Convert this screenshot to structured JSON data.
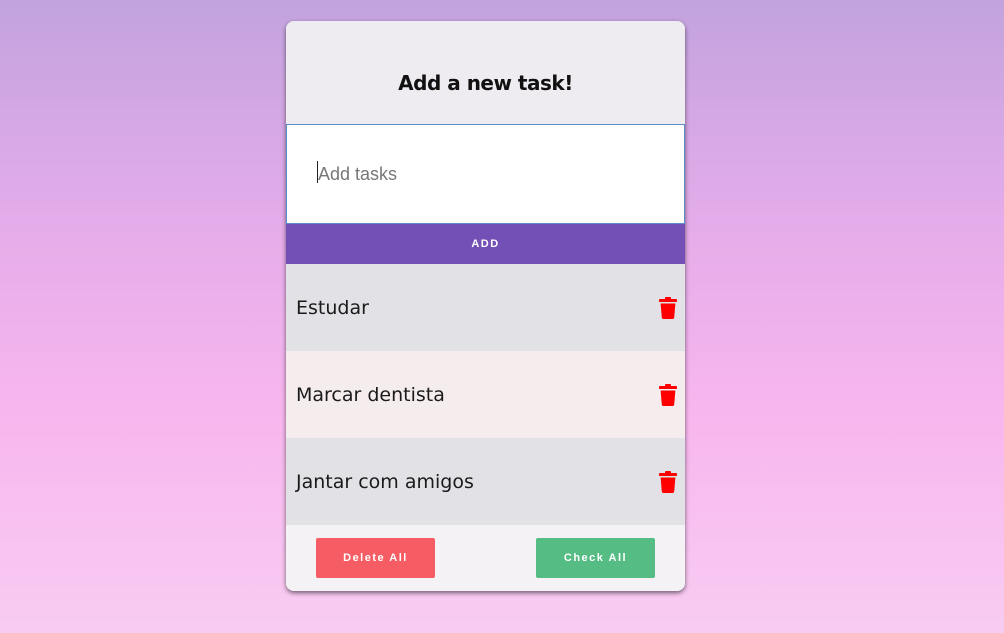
{
  "header": {
    "title": "Add a new task!"
  },
  "input": {
    "placeholder": "Add tasks",
    "value": ""
  },
  "add_button": {
    "label": "ADD"
  },
  "tasks": [
    {
      "label": "Estudar",
      "icon": "trash-icon"
    },
    {
      "label": "Marcar dentista",
      "icon": "trash-icon"
    },
    {
      "label": "Jantar com amigos",
      "icon": "trash-icon"
    }
  ],
  "footer": {
    "delete_all_label": "Delete All",
    "check_all_label": "Check All"
  },
  "colors": {
    "accent": "#7350b6",
    "delete": "#f55c63",
    "check": "#55bd84",
    "trash": "#ff0000"
  }
}
